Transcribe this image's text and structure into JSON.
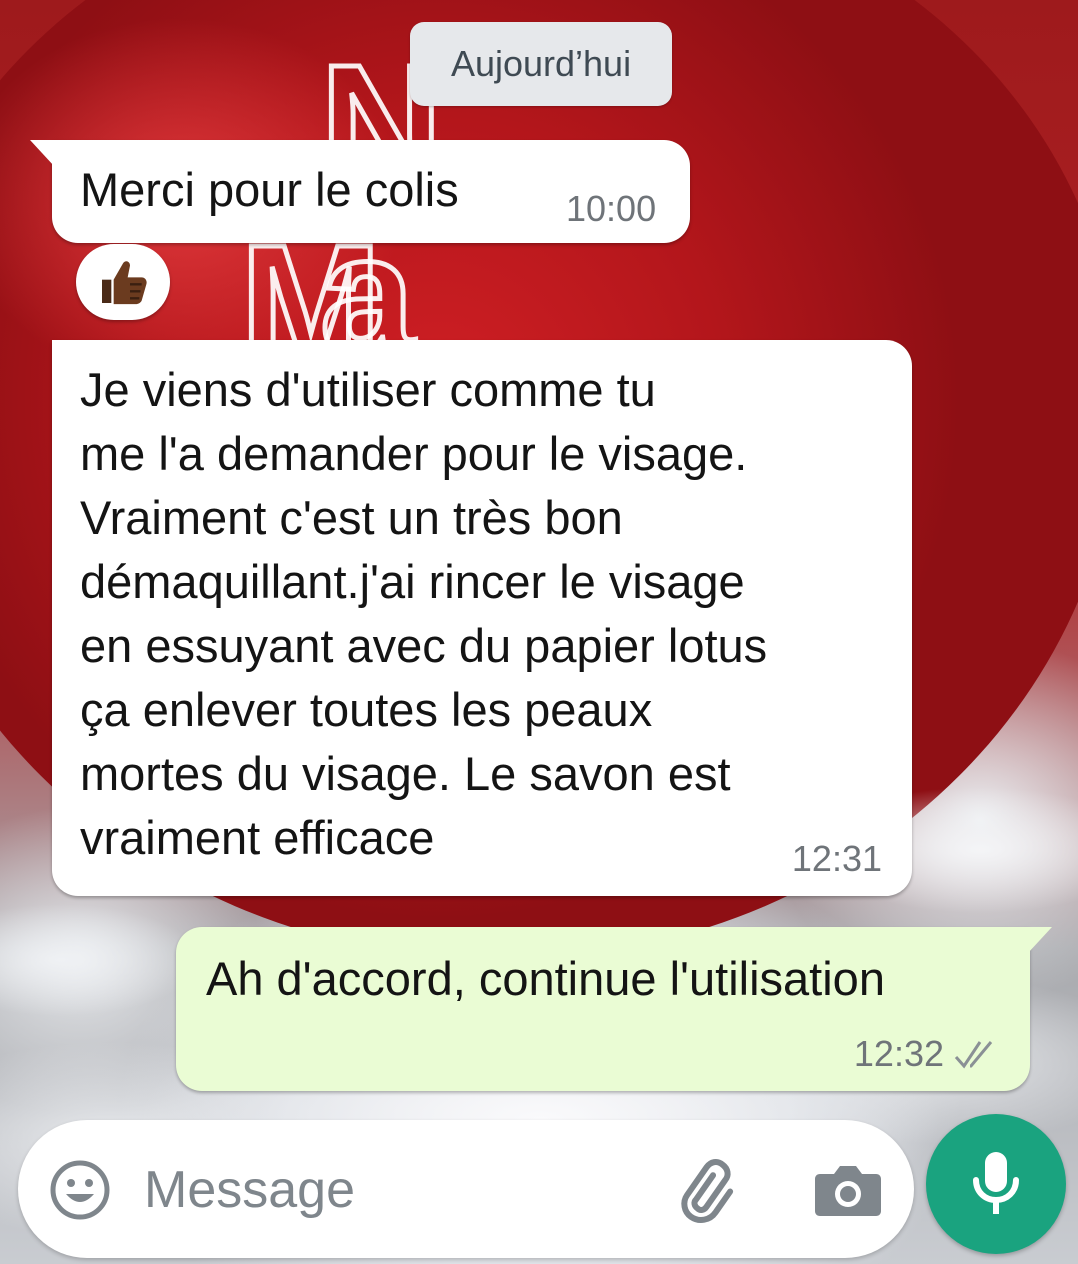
{
  "chat": {
    "date_chip": "Aujourd’hui",
    "messages": [
      {
        "direction": "incoming",
        "text": "Merci pour le colis",
        "time": "10:00",
        "reaction": "thumbs-up-icon"
      },
      {
        "direction": "incoming",
        "text": "Je viens d'utiliser comme tu\nme l'a demander pour le visage.\nVraiment c'est un très bon\ndémaquillant.j'ai rincer le visage\nen essuyant avec du papier lotus\nça enlever toutes les peaux\nmortes du visage. Le savon est\nvraiment efficace",
        "time": "12:31"
      },
      {
        "direction": "outgoing",
        "text": "Ah d'accord, continue l'utilisation",
        "time": "12:32",
        "status": "double-check-icon"
      }
    ]
  },
  "composer": {
    "placeholder": "Message",
    "icons": [
      "emoji-icon",
      "attach-icon",
      "camera-icon",
      "microphone-icon"
    ]
  },
  "colors": {
    "incoming_bubble": "#ffffff",
    "outgoing_bubble": "#eafcd4",
    "mic_button": "#1aa37f",
    "date_chip": "#e6e8eb"
  }
}
